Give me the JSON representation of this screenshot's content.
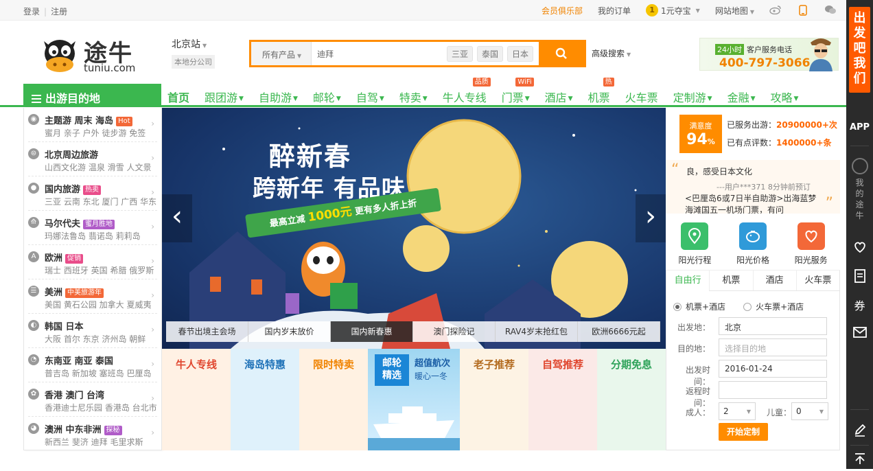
{
  "topbar": {
    "login": "登录",
    "register": "注册",
    "vip_club": "会员俱乐部",
    "my_orders": "我的订单",
    "coin_value": "1",
    "coin_treasure": "1元夺宝",
    "site_map": "网站地图"
  },
  "header": {
    "logo_name": "途牛",
    "logo_domain": "tuniu.com",
    "station": "北京站",
    "station_sub": "本地分公司",
    "search_category": "所有产品",
    "search_value": "迪拜",
    "search_tags": [
      "三亚",
      "泰国",
      "日本"
    ],
    "advanced_search": "高级搜索",
    "service_24h": "24小时",
    "service_label": "客户服务电话",
    "service_phone": "400-797-3066"
  },
  "nav": {
    "destinations": "出游目的地",
    "items": [
      {
        "label": "首页",
        "arrow": false,
        "badge": ""
      },
      {
        "label": "跟团游",
        "arrow": true,
        "badge": ""
      },
      {
        "label": "自助游",
        "arrow": true,
        "badge": ""
      },
      {
        "label": "邮轮",
        "arrow": true,
        "badge": ""
      },
      {
        "label": "自驾",
        "arrow": true,
        "badge": ""
      },
      {
        "label": "特卖",
        "arrow": true,
        "badge": ""
      },
      {
        "label": "牛人专线",
        "arrow": false,
        "badge": "品质"
      },
      {
        "label": "门票",
        "arrow": true,
        "badge": "WiFi"
      },
      {
        "label": "酒店",
        "arrow": true,
        "badge": ""
      },
      {
        "label": "机票",
        "arrow": false,
        "badge": "热"
      },
      {
        "label": "火车票",
        "arrow": false,
        "badge": ""
      },
      {
        "label": "定制游",
        "arrow": true,
        "badge": ""
      },
      {
        "label": "金融",
        "arrow": true,
        "badge": ""
      },
      {
        "label": "攻略",
        "arrow": true,
        "badge": ""
      }
    ]
  },
  "destinations": [
    {
      "title": "主题游 周末 海岛",
      "tag": "Hot",
      "tag_color": "#f36838",
      "subs": "蜜月 亲子 户外 徒步游 免签"
    },
    {
      "title": "北京周边旅游",
      "tag": "",
      "tag_color": "",
      "subs": "山西文化游 温泉 滑雪 人文景"
    },
    {
      "title": "国内旅游",
      "tag": "热卖",
      "tag_color": "#e94d8a",
      "subs": "三亚 云南 东北 厦门 广西 华东"
    },
    {
      "title": "马尔代夫",
      "tag": "蜜月胜地",
      "tag_color": "#b05cc8",
      "subs": "玛娜法鲁岛 翡诺岛 莉莉岛"
    },
    {
      "title": "欧洲",
      "tag": "促销",
      "tag_color": "#e94d8a",
      "subs": "瑞士 西班牙 英国 希腊 俄罗斯"
    },
    {
      "title": "美洲",
      "tag": "中美旅游年",
      "tag_color": "#f36838",
      "subs": "美国 黄石公园 加拿大 夏威夷"
    },
    {
      "title": "韩国 日本",
      "tag": "",
      "tag_color": "",
      "subs": "大阪 首尔 东京 济州岛 朝鲜"
    },
    {
      "title": "东南亚 南亚 泰国",
      "tag": "",
      "tag_color": "",
      "subs": "普吉岛 新加坡 塞班岛 巴厘岛"
    },
    {
      "title": "香港 澳门 台湾",
      "tag": "",
      "tag_color": "",
      "subs": "香港迪士尼乐园 香港岛 台北市"
    },
    {
      "title": "澳洲 中东非洲",
      "tag": "探秘",
      "tag_color": "#b05cc8",
      "subs": "新西兰 斐济 迪拜 毛里求斯"
    }
  ],
  "banner": {
    "headline1": "醉新春",
    "headline2": "跨新年 有品味",
    "ribbon_pre": "最高立减",
    "ribbon_amount": "1000元",
    "ribbon_post": "更有多人折上折",
    "tabs": [
      "春节出境主会场",
      "国内岁末放价",
      "国内新春惠",
      "澳门探险记",
      "RAV4岁末抢红包",
      "欧洲6666元起"
    ],
    "active_tab": 2
  },
  "promos": [
    {
      "label": "牛人专线",
      "color": "#e0462e",
      "bg": "#fff1e4"
    },
    {
      "label": "海岛特惠",
      "color": "#1f72b8",
      "bg": "#dff1fb"
    },
    {
      "label": "限时特卖",
      "color": "#f08300",
      "bg": "#fff1e2"
    },
    {
      "label": "老子推荐",
      "color": "#b36b1f",
      "bg": "#fdf3e4"
    },
    {
      "label": "自驾推荐",
      "color": "#e0462e",
      "bg": "#fbe9e7"
    },
    {
      "label": "分期免息",
      "color": "#2fa35a",
      "bg": "#e9f7ec"
    }
  ],
  "cruise_promo": {
    "head1": "邮轮",
    "head2": "精选",
    "text1": "超值航次",
    "text2": "暖心一冬"
  },
  "stats": {
    "satisfaction_label": "满意度",
    "satisfaction_value": "94",
    "satisfaction_unit": "%",
    "served_label": "已服务出游：",
    "served_value": "20900000+次",
    "reviews_label": "已有点评数：",
    "reviews_value": "1400000+条"
  },
  "review": {
    "line1": "良，感受日本文化",
    "line2": "---用户***371 8分钟前预订",
    "line3": "<巴厘岛6或7日半自助游>出海蓝梦",
    "line4": "海滩国五一机场门票，有问"
  },
  "sunshine": [
    {
      "label": "阳光行程",
      "color": "#3bbf6b"
    },
    {
      "label": "阳光价格",
      "color": "#2f9ad9"
    },
    {
      "label": "阳光服务",
      "color": "#f36838"
    }
  ],
  "booking": {
    "tabs": [
      "自由行",
      "机票",
      "酒店",
      "火车票"
    ],
    "radio1": "机票+酒店",
    "radio2": "火车票+酒店",
    "from_label": "出发地：",
    "from_value": "北京",
    "to_label": "目的地：",
    "to_placeholder": "选择目的地",
    "depart_label": "出发时间：",
    "depart_value": "2016-01-24",
    "return_label": "返程时间：",
    "return_value": "",
    "adults_label": "成人：",
    "adults_value": "2",
    "children_label": "儿童：",
    "children_value": "0",
    "submit": "开始定制"
  },
  "sidebar": {
    "promo": "出发吧我们",
    "app": "APP",
    "mine": "我的途牛",
    "coupon": "券"
  }
}
